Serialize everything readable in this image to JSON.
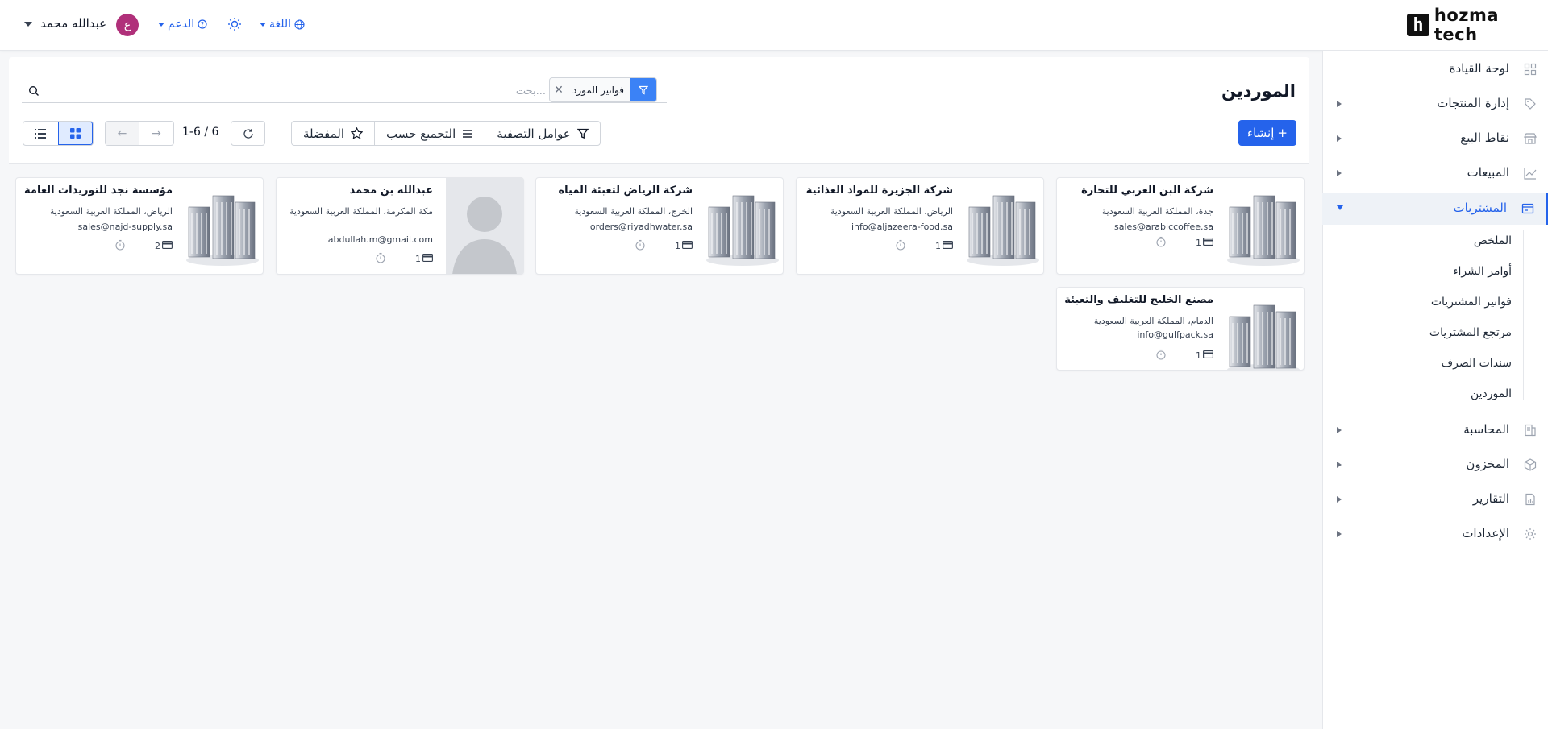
{
  "topbar": {
    "user_name": "عبدالله محمد",
    "avatar_initial": "ع",
    "avatar_color": "#b0307a",
    "support_label": "الدعم",
    "language_label": "اللغة",
    "logo_text": "hozma tech",
    "logo_mark": "h"
  },
  "sidebar": {
    "items": [
      {
        "label": "لوحة القيادة",
        "icon": "dashboard-icon"
      },
      {
        "label": "إدارة المنتجات",
        "icon": "tag-icon"
      },
      {
        "label": "نقاط البيع",
        "icon": "store-icon"
      },
      {
        "label": "المبيعات",
        "icon": "chart-line-icon"
      },
      {
        "label": "المشتريات",
        "icon": "wallet-icon"
      },
      {
        "label": "المحاسبة",
        "icon": "ledger-icon"
      },
      {
        "label": "المخزون",
        "icon": "box-icon"
      },
      {
        "label": "التقارير",
        "icon": "report-icon"
      },
      {
        "label": "الإعدادات",
        "icon": "gear-icon"
      }
    ],
    "purchases_sub": [
      "الملخص",
      "أوامر الشراء",
      "فواتير المشتريات",
      "مرتجع المشتريات",
      "سندات الصرف",
      "الموردين"
    ]
  },
  "main": {
    "title": "الموردين",
    "search_placeholder": "بحث...",
    "facet_label": "فواتير المورد",
    "create_label": "إنشاء",
    "filters_label": "عوامل التصفية",
    "groupby_label": "التجميع حسب",
    "favorites_label": "المفضلة",
    "pager": "1-6 / 6",
    "accent": "#2563eb"
  },
  "cards": [
    {
      "name": "شركة البن العربي للتجارة",
      "address": "جدة، المملكة العربية السعودية",
      "email": "sales@arabiccoffee.sa",
      "count": "1"
    },
    {
      "name": "شركة الجزيرة للمواد الغذائية",
      "address": "الرياض، المملكة العربية السعودية",
      "email": "info@aljazeera-food.sa",
      "count": "1"
    },
    {
      "name": "شركة الرياض لتعبئة المياه",
      "address": "الخرج، المملكة العربية السعودية",
      "email": "orders@riyadhwater.sa",
      "count": "1"
    },
    {
      "name": "عبدالله بن محمد",
      "address": "مكة المكرمة، المملكة العربية السعودية",
      "email": "abdullah.m@gmail.com",
      "count": "1"
    },
    {
      "name": "مؤسسة نجد للتوريدات العامة",
      "address": "الرياض، المملكة العربية السعودية",
      "email": "sales@najd-supply.sa",
      "count": "2"
    },
    {
      "name": "مصنع الخليج للتغليف والتعبئة",
      "address": "الدمام، المملكة العربية السعودية",
      "email": "info@gulfpack.sa",
      "count": "1"
    }
  ]
}
